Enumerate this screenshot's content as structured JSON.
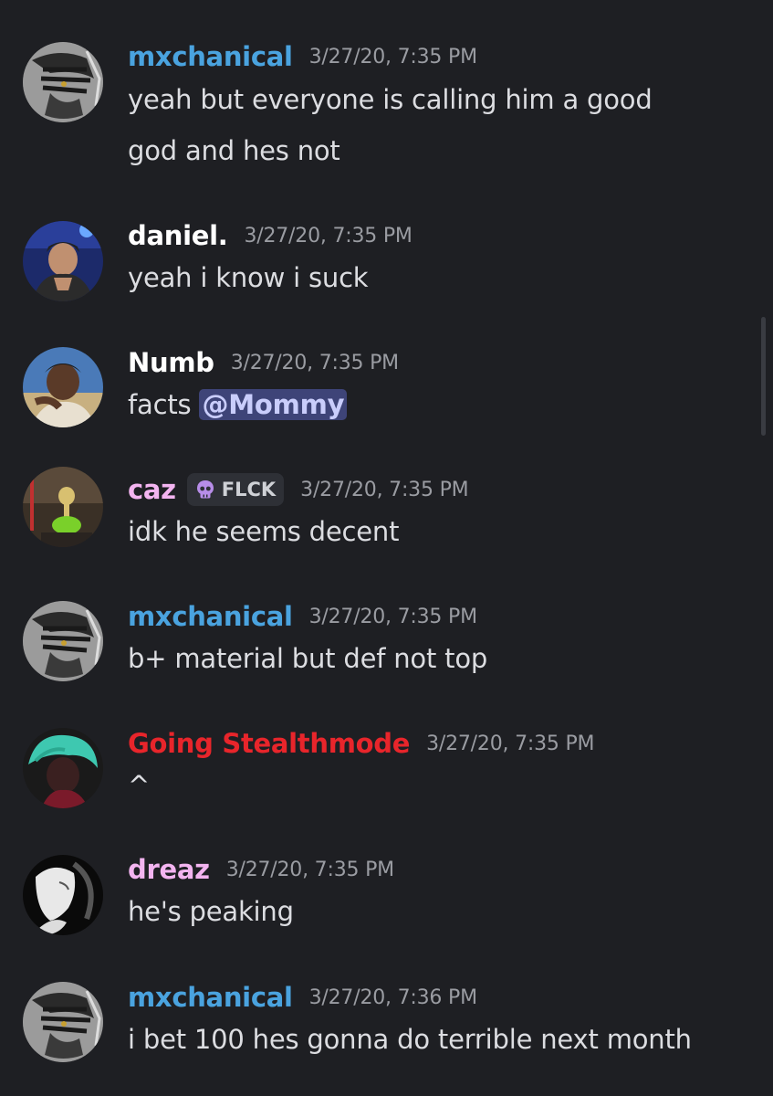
{
  "colors": {
    "background": "#1e1f23",
    "text": "#dcdde1",
    "timestamp": "#9a9ca2",
    "mention_bg": "#3e4478"
  },
  "messages": [
    {
      "username": "mxchanical",
      "username_color": "#4aa3df",
      "avatar": "anime-mask-avatar",
      "timestamp": "3/27/20, 7:35 PM",
      "text": "yeah but everyone is calling him a good god and hes not"
    },
    {
      "username": "daniel.",
      "username_color": "#ffffff",
      "avatar": "gamer-on-stage-avatar",
      "timestamp": "3/27/20, 7:35 PM",
      "text": "yeah i know i suck"
    },
    {
      "username": "Numb",
      "username_color": "#ffffff",
      "avatar": "person-photo-avatar",
      "timestamp": "3/27/20, 7:35 PM",
      "text": "facts",
      "mention": "@Mommy"
    },
    {
      "username": "caz",
      "username_color": "#f3b4f0",
      "avatar": "green-figure-avatar",
      "timestamp": "3/27/20, 7:35 PM",
      "tag": "FLCK",
      "tag_icon": "skull-icon",
      "text": "idk he seems decent"
    },
    {
      "username": "mxchanical",
      "username_color": "#4aa3df",
      "avatar": "anime-mask-avatar",
      "timestamp": "3/27/20, 7:35 PM",
      "text": "b+ material but def not top"
    },
    {
      "username": "Going Stealthmode",
      "username_color": "#e8252b",
      "avatar": "teal-hair-avatar",
      "timestamp": "3/27/20, 7:35 PM",
      "text": "^"
    },
    {
      "username": "dreaz",
      "username_color": "#f3b4f0",
      "avatar": "monochrome-face-avatar",
      "timestamp": "3/27/20, 7:35 PM",
      "text": "he's peaking"
    },
    {
      "username": "mxchanical",
      "username_color": "#4aa3df",
      "avatar": "anime-mask-avatar",
      "timestamp": "3/27/20, 7:36 PM",
      "text": "i bet 100 hes gonna do terrible next month"
    }
  ]
}
